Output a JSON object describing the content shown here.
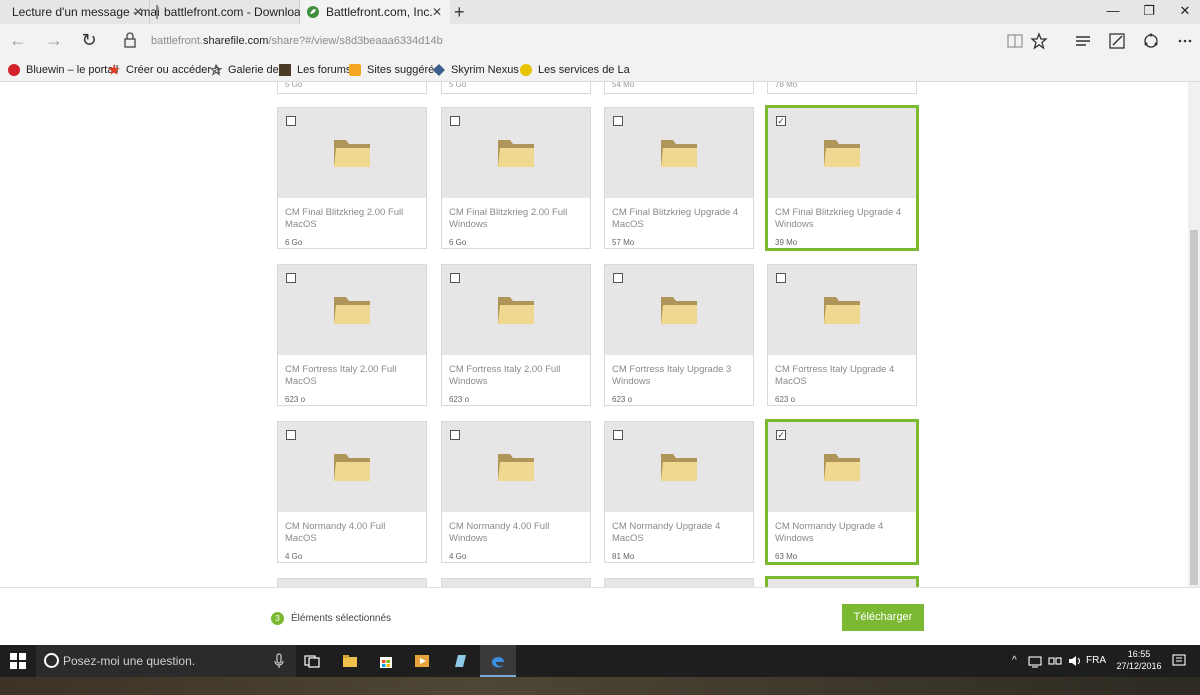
{
  "browser": {
    "tabs": [
      {
        "title": "Lecture d'un message - mai",
        "close": "✕"
      },
      {
        "title": "battlefront.com - Download",
        "close": "✕"
      },
      {
        "title": "Battlefront.com, Inc.",
        "close": "✕"
      }
    ],
    "new_tab": "+",
    "window_controls": {
      "minimize": "—",
      "maximize": "❐",
      "close": "✕"
    },
    "nav": {
      "back": "←",
      "forward": "→",
      "refresh": "↻"
    },
    "url_prefix": "battlefront.",
    "url_host": "sharefile.com",
    "url_path": "/share?#/view/s8d3beaaa6334d14b",
    "favorites": [
      {
        "label": "Bluewin – le portail",
        "color": "#d2232a"
      },
      {
        "label": "Créer ou accéder à",
        "color": "#e23b1f"
      },
      {
        "label": "Galerie de",
        "color": "#555555"
      },
      {
        "label": "Les forums",
        "color": "#4a3b25"
      },
      {
        "label": "Sites suggérés",
        "color": "#f5a623"
      },
      {
        "label": "Skyrim Nexus -",
        "color": "#3b5f8c"
      },
      {
        "label": "Les services de La",
        "color": "#e8c300"
      }
    ]
  },
  "partial_row": [
    "5 Go",
    "5 Go",
    "54 Mo",
    "78 Mo"
  ],
  "files": [
    {
      "name": "CM Final Blitzkrieg 2.00 Full MacOS",
      "size": "6 Go",
      "selected": false
    },
    {
      "name": "CM Final Blitzkrieg 2.00 Full Windows",
      "size": "6 Go",
      "selected": false
    },
    {
      "name": "CM Final Blitzkrieg Upgrade 4 MacOS",
      "size": "57 Mo",
      "selected": false
    },
    {
      "name": "CM Final Blitzkrieg Upgrade 4 Windows",
      "size": "39 Mo",
      "selected": true
    },
    {
      "name": "CM Fortress Italy 2.00 Full MacOS",
      "size": "623 o",
      "selected": false
    },
    {
      "name": "CM Fortress Italy 2.00 Full Windows",
      "size": "623 o",
      "selected": false
    },
    {
      "name": "CM Fortress Italy Upgrade 3 Windows",
      "size": "623 o",
      "selected": false
    },
    {
      "name": "CM Fortress Italy Upgrade 4 MacOS",
      "size": "623 o",
      "selected": false
    },
    {
      "name": "CM Normandy 4.00 Full MacOS",
      "size": "4 Go",
      "selected": false
    },
    {
      "name": "CM Normandy 4.00 Full Windows",
      "size": "4 Go",
      "selected": false
    },
    {
      "name": "CM Normandy Upgrade 4 MacOS",
      "size": "81 Mo",
      "selected": false
    },
    {
      "name": "CM Normandy Upgrade 4 Windows",
      "size": "63 Mo",
      "selected": true
    }
  ],
  "next_row_selected": [
    false,
    false,
    false,
    true
  ],
  "footer": {
    "count": "3",
    "selected_label": "Éléments sélectionnés",
    "download_label": "Télécharger"
  },
  "colors": {
    "accent": "#7cb933",
    "folder": "#f0d890",
    "folder_tab": "#b0955a"
  },
  "taskbar": {
    "search_placeholder": "Posez-moi une question.",
    "language": "FRA",
    "time": "16:55",
    "date": "27/12/2016"
  }
}
